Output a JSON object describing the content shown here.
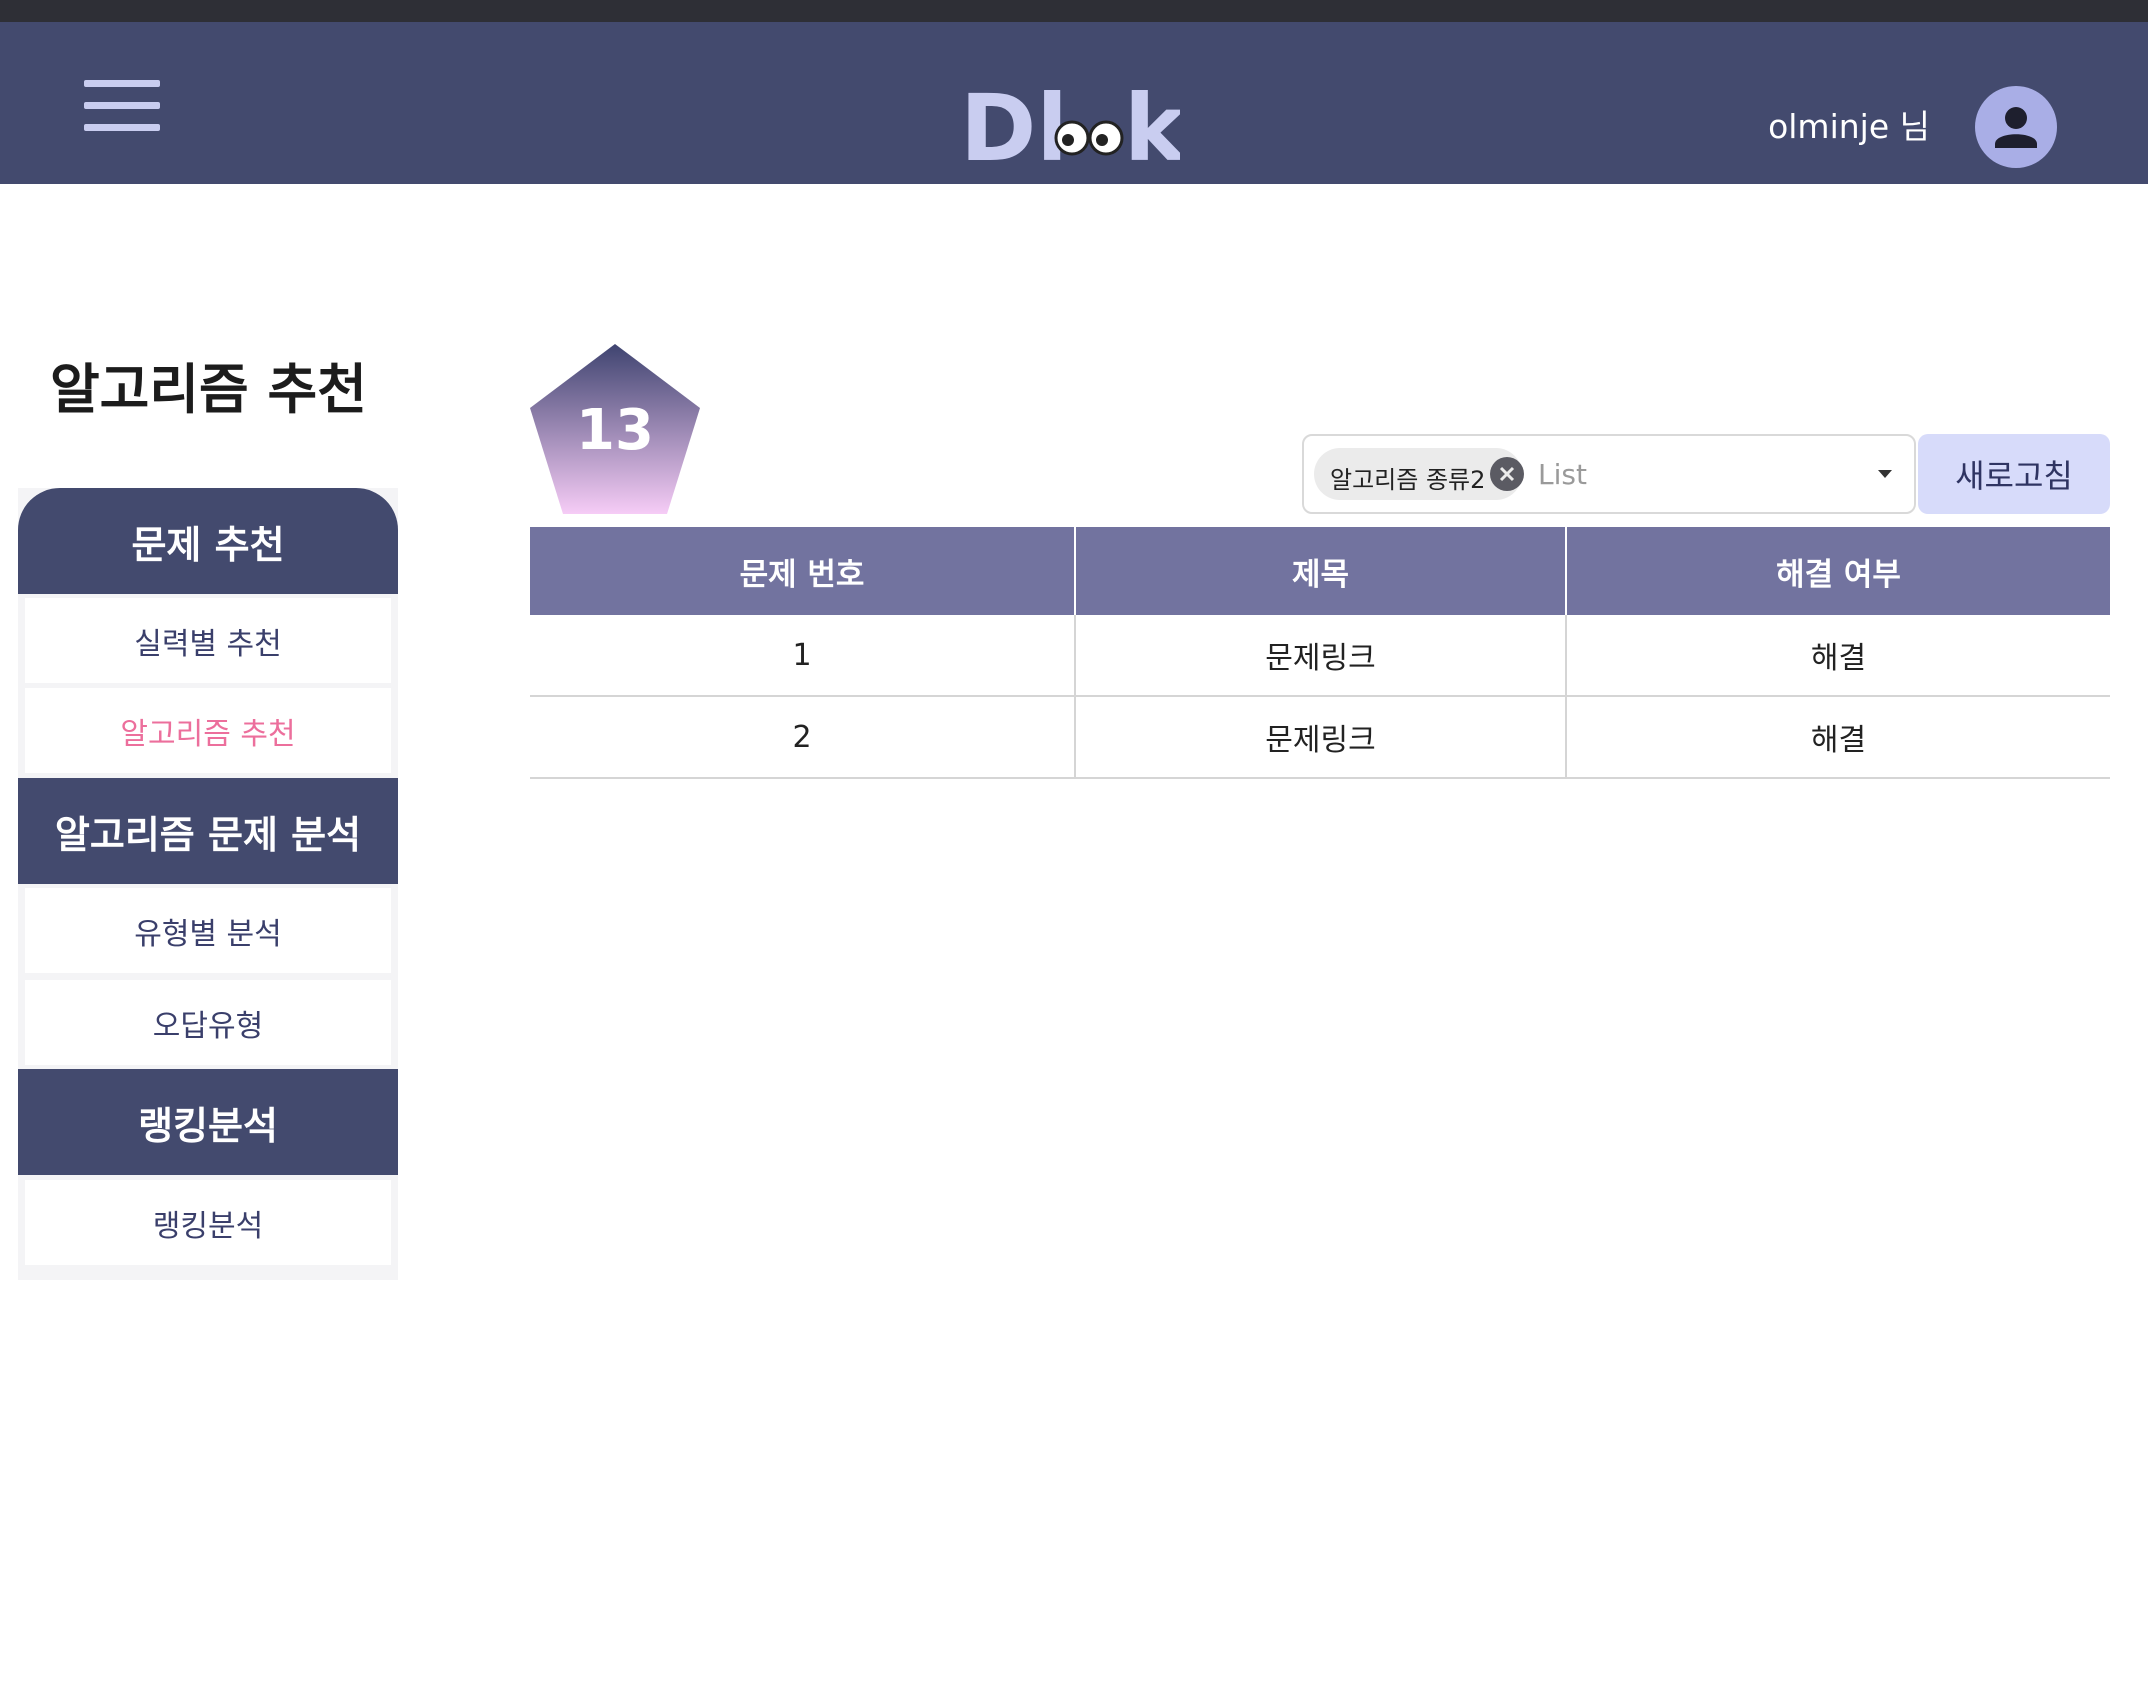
{
  "header": {
    "logo_text": "Dlook",
    "username": "olminje 님"
  },
  "page": {
    "title": "알고리즘 추천",
    "tier_number": "13"
  },
  "sidebar": {
    "sections": [
      {
        "title": "문제 추천",
        "items": [
          "실력별 추천",
          "알고리즘 추천"
        ]
      },
      {
        "title": "알고리즘 문제 분석",
        "items": [
          "유형별 분석",
          "오답유형"
        ]
      },
      {
        "title": "랭킹분석",
        "items": [
          "랭킹분석"
        ]
      }
    ],
    "active_item": "알고리즘 추천"
  },
  "filter": {
    "chip_label": "알고리즘 종류2",
    "placeholder": "List",
    "refresh_label": "새로고침"
  },
  "table": {
    "headers": [
      "문제 번호",
      "제목",
      "해결 여부"
    ],
    "rows": [
      [
        "1",
        "문제링크",
        "해결"
      ],
      [
        "2",
        "문제링크",
        "해결"
      ]
    ]
  },
  "colors": {
    "header_bg": "#434a6e",
    "table_header_bg": "#72739f",
    "active_text": "#ec6f9c",
    "button_bg": "#d7dbfa"
  }
}
